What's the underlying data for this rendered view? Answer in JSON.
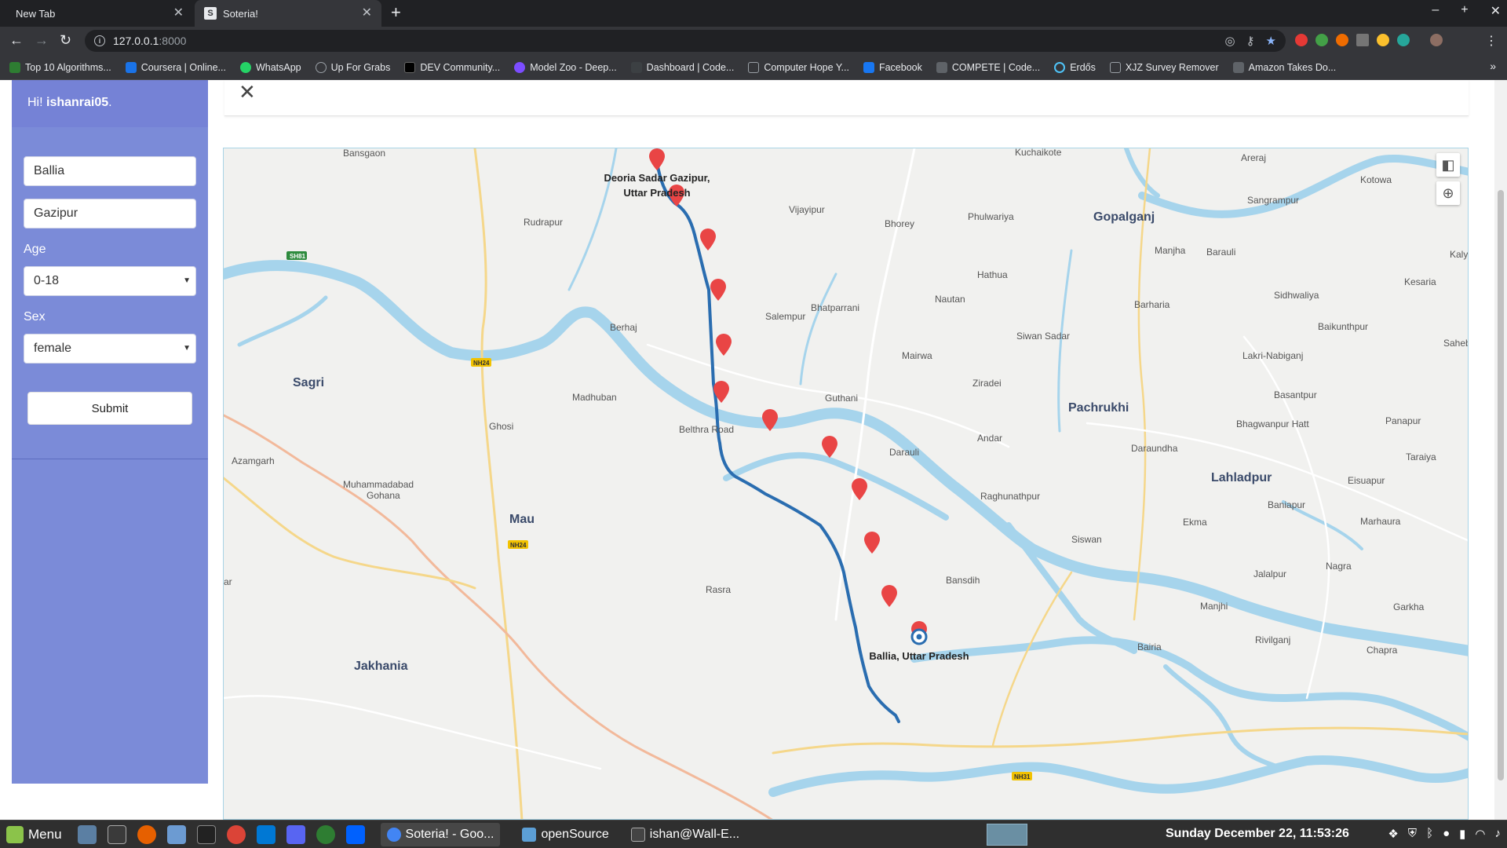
{
  "browser": {
    "tabs": [
      {
        "title": "New Tab",
        "active": false
      },
      {
        "title": "Soteria!",
        "active": true,
        "favicon": "S"
      }
    ],
    "url_host": "127.0.0.1",
    "url_port": ":8000",
    "bookmarks": [
      {
        "label": "Top 10 Algorithms...",
        "color": "#2e7d32"
      },
      {
        "label": "Coursera | Online...",
        "color": "#1a73e8"
      },
      {
        "label": "WhatsApp",
        "color": "#25d366"
      },
      {
        "label": "Up For Grabs",
        "color": "#9aa0a6"
      },
      {
        "label": "DEV Community...",
        "color": "#000000"
      },
      {
        "label": "Model Zoo - Deep...",
        "color": "#7c4dff"
      },
      {
        "label": "Dashboard | Code...",
        "color": "#3c4043"
      },
      {
        "label": "Computer Hope Y...",
        "color": "#9aa0a6"
      },
      {
        "label": "Facebook",
        "color": "#1877f2"
      },
      {
        "label": "COMPETE | Code...",
        "color": "#5f6368"
      },
      {
        "label": "Erdős",
        "color": "#4fc3f7"
      },
      {
        "label": "XJZ Survey Remover",
        "color": "#9aa0a6"
      },
      {
        "label": "Amazon Takes Do...",
        "color": "#5f6368"
      }
    ]
  },
  "sidebar": {
    "greeting_prefix": "Hi! ",
    "username": "ishanrai05",
    "greeting_suffix": ".",
    "source_value": "Ballia",
    "destination_value": "Gazipur",
    "age_label": "Age",
    "age_value": "0-18",
    "sex_label": "Sex",
    "sex_value": "female",
    "submit_label": "Submit"
  },
  "map": {
    "start_label_line1": "Deoria Sadar Gazipur,",
    "start_label_line2": "Uttar Pradesh",
    "end_label": "Ballia, Uttar Pradesh",
    "place_labels": [
      {
        "text": "Bansgaon",
        "major": false
      },
      {
        "text": "Kuchaikote",
        "major": false
      },
      {
        "text": "Areraj",
        "major": false
      },
      {
        "text": "Kotowa",
        "major": false
      },
      {
        "text": "Sangrampur",
        "major": false
      },
      {
        "text": "Gopalganj",
        "major": true
      },
      {
        "text": "Rudrapur",
        "major": false
      },
      {
        "text": "Vijayipur",
        "major": false
      },
      {
        "text": "Bhorey",
        "major": false
      },
      {
        "text": "Phulwariya",
        "major": false
      },
      {
        "text": "Manjha",
        "major": false
      },
      {
        "text": "Barauli",
        "major": false
      },
      {
        "text": "Kalya",
        "major": false
      },
      {
        "text": "Kesaria",
        "major": false
      },
      {
        "text": "Hathua",
        "major": false
      },
      {
        "text": "Nautan",
        "major": false
      },
      {
        "text": "Barharia",
        "major": false
      },
      {
        "text": "Sidhwaliya",
        "major": false
      },
      {
        "text": "Bhatparrani",
        "major": false
      },
      {
        "text": "Salempur",
        "major": false
      },
      {
        "text": "Berhaj",
        "major": false
      },
      {
        "text": "Baikunthpur",
        "major": false
      },
      {
        "text": "Siwan Sadar",
        "major": false
      },
      {
        "text": "Saheb",
        "major": false
      },
      {
        "text": "Mairwa",
        "major": false
      },
      {
        "text": "Lakri-Nabiganj",
        "major": false
      },
      {
        "text": "Sagri",
        "major": true
      },
      {
        "text": "Ziradei",
        "major": false
      },
      {
        "text": "Madhuban",
        "major": false
      },
      {
        "text": "Guthani",
        "major": false
      },
      {
        "text": "Basantpur",
        "major": false
      },
      {
        "text": "Pachrukhi",
        "major": true
      },
      {
        "text": "Bhagwanpur Hatt",
        "major": false
      },
      {
        "text": "Panapur",
        "major": false
      },
      {
        "text": "Ghosi",
        "major": false
      },
      {
        "text": "Belthra Road",
        "major": false
      },
      {
        "text": "Andar",
        "major": false
      },
      {
        "text": "Darauli",
        "major": false
      },
      {
        "text": "Daraundha",
        "major": false
      },
      {
        "text": "Taraiya",
        "major": false
      },
      {
        "text": "Azamgarh",
        "major": false
      },
      {
        "text": "Lahladpur",
        "major": true
      },
      {
        "text": "Eisuapur",
        "major": false
      },
      {
        "text": "Muhammadabad",
        "major": false
      },
      {
        "text": "Gohana",
        "major": false
      },
      {
        "text": "Raghunathpur",
        "major": false
      },
      {
        "text": "Baniapur",
        "major": false
      },
      {
        "text": "Mau",
        "major": true
      },
      {
        "text": "Ekma",
        "major": false
      },
      {
        "text": "Marhaura",
        "major": false
      },
      {
        "text": "Siswan",
        "major": false
      },
      {
        "text": "Nagra",
        "major": false
      },
      {
        "text": "Jalalpur",
        "major": false
      },
      {
        "text": "Bansdih",
        "major": false
      },
      {
        "text": "ar",
        "major": false
      },
      {
        "text": "Rasra",
        "major": false
      },
      {
        "text": "Manjhi",
        "major": false
      },
      {
        "text": "Garkha",
        "major": false
      },
      {
        "text": "Rivilganj",
        "major": false
      },
      {
        "text": "Chapra",
        "major": false
      },
      {
        "text": "Bairia",
        "major": false
      },
      {
        "text": "Jakhania",
        "major": true
      }
    ],
    "road_shields": [
      "SH81",
      "NH24",
      "NH24",
      "NH31"
    ]
  },
  "taskbar": {
    "menu_label": "Menu",
    "tasks": [
      {
        "label": "Soteria! - Goo...",
        "color": "#4285f4"
      },
      {
        "label": "openSource",
        "color": "#5c9fd6"
      },
      {
        "label": "ishan@Wall-E...",
        "color": "#444444"
      }
    ],
    "clock": "Sunday December 22, 11:53:26"
  },
  "colors": {
    "sidebar": "#7b8bd8",
    "route": "#2a6db0",
    "marker": "#e94545",
    "water": "#a6d4ec"
  }
}
